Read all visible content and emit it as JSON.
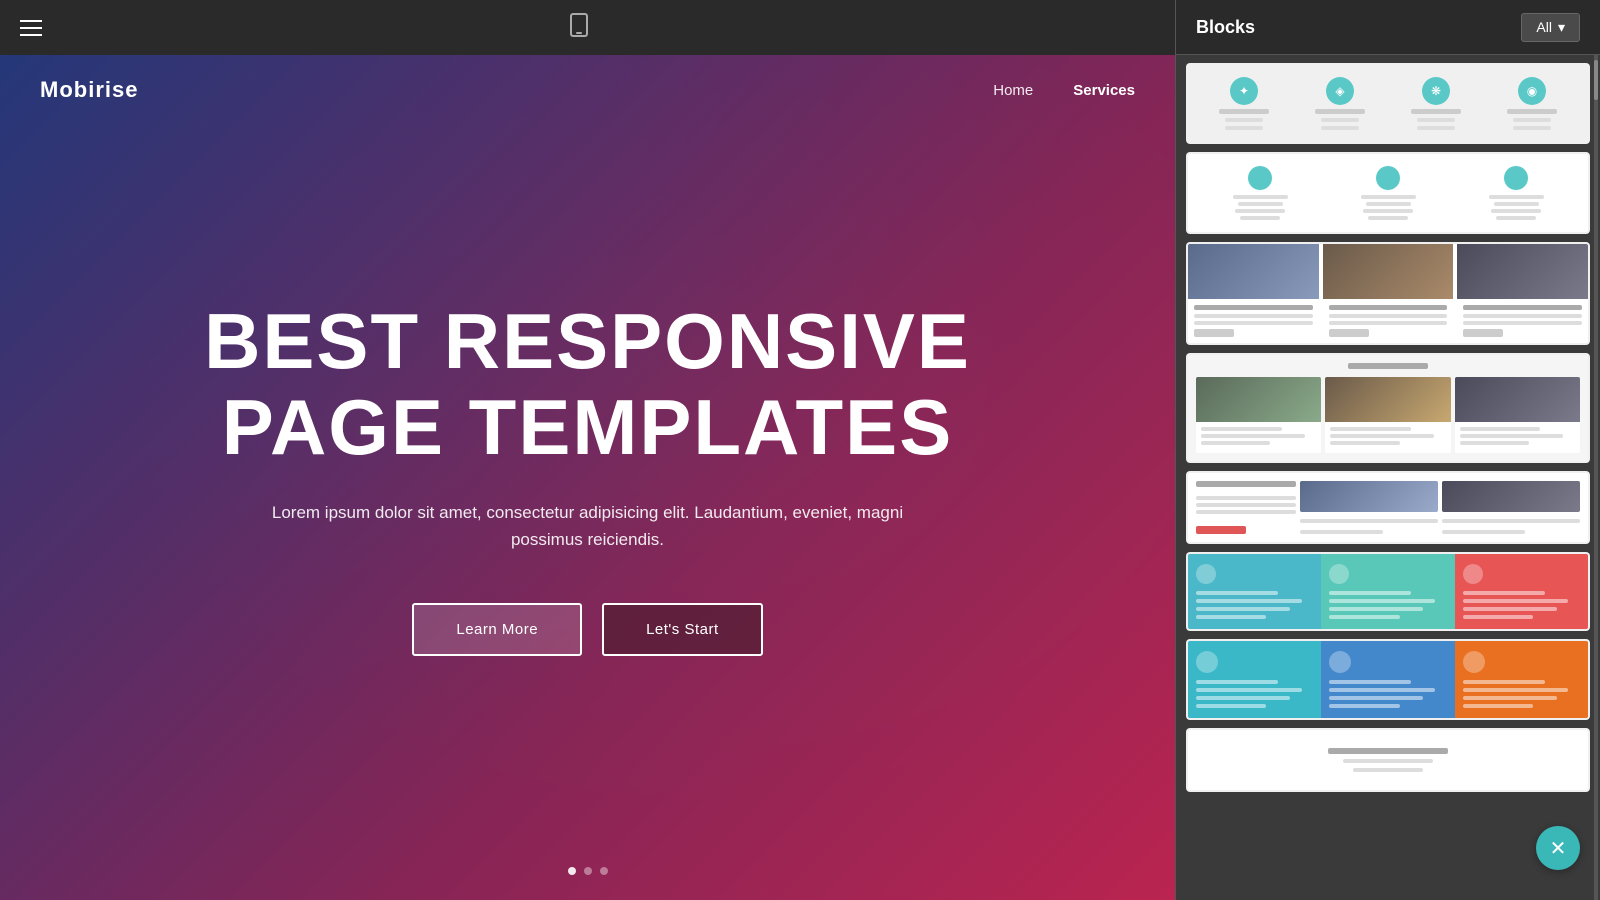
{
  "toolbar": {
    "hamburger_label": "menu"
  },
  "hero": {
    "logo": "Mobirise",
    "nav": {
      "home": "Home",
      "services": "Services"
    },
    "title_line1": "BEST RESPONSIVE",
    "title_line2": "PAGE TEMPLATES",
    "subtitle": "Lorem ipsum dolor sit amet, consectetur adipisicing elit. Laudantium, eveniet, magni possimus reiciendis.",
    "btn_learn_more": "Learn More",
    "btn_lets_start": "Let's Start"
  },
  "blocks_panel": {
    "title": "Blocks",
    "filter_btn": "All",
    "filter_arrow": "▾"
  }
}
